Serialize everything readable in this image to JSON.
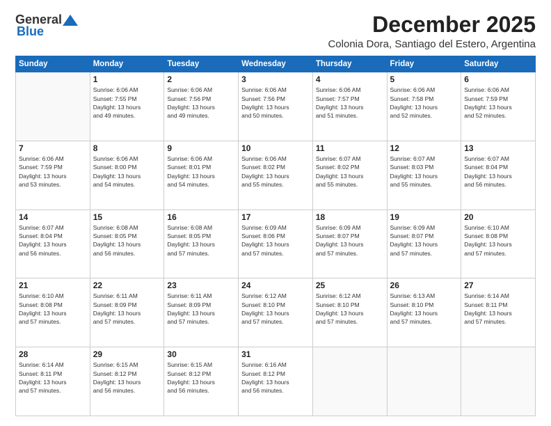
{
  "logo": {
    "general": "General",
    "blue": "Blue"
  },
  "header": {
    "month": "December 2025",
    "location": "Colonia Dora, Santiago del Estero, Argentina"
  },
  "weekdays": [
    "Sunday",
    "Monday",
    "Tuesday",
    "Wednesday",
    "Thursday",
    "Friday",
    "Saturday"
  ],
  "weeks": [
    [
      {
        "day": "",
        "info": ""
      },
      {
        "day": "1",
        "info": "Sunrise: 6:06 AM\nSunset: 7:55 PM\nDaylight: 13 hours\nand 49 minutes."
      },
      {
        "day": "2",
        "info": "Sunrise: 6:06 AM\nSunset: 7:56 PM\nDaylight: 13 hours\nand 49 minutes."
      },
      {
        "day": "3",
        "info": "Sunrise: 6:06 AM\nSunset: 7:56 PM\nDaylight: 13 hours\nand 50 minutes."
      },
      {
        "day": "4",
        "info": "Sunrise: 6:06 AM\nSunset: 7:57 PM\nDaylight: 13 hours\nand 51 minutes."
      },
      {
        "day": "5",
        "info": "Sunrise: 6:06 AM\nSunset: 7:58 PM\nDaylight: 13 hours\nand 52 minutes."
      },
      {
        "day": "6",
        "info": "Sunrise: 6:06 AM\nSunset: 7:59 PM\nDaylight: 13 hours\nand 52 minutes."
      }
    ],
    [
      {
        "day": "7",
        "info": "Sunrise: 6:06 AM\nSunset: 7:59 PM\nDaylight: 13 hours\nand 53 minutes."
      },
      {
        "day": "8",
        "info": "Sunrise: 6:06 AM\nSunset: 8:00 PM\nDaylight: 13 hours\nand 54 minutes."
      },
      {
        "day": "9",
        "info": "Sunrise: 6:06 AM\nSunset: 8:01 PM\nDaylight: 13 hours\nand 54 minutes."
      },
      {
        "day": "10",
        "info": "Sunrise: 6:06 AM\nSunset: 8:02 PM\nDaylight: 13 hours\nand 55 minutes."
      },
      {
        "day": "11",
        "info": "Sunrise: 6:07 AM\nSunset: 8:02 PM\nDaylight: 13 hours\nand 55 minutes."
      },
      {
        "day": "12",
        "info": "Sunrise: 6:07 AM\nSunset: 8:03 PM\nDaylight: 13 hours\nand 55 minutes."
      },
      {
        "day": "13",
        "info": "Sunrise: 6:07 AM\nSunset: 8:04 PM\nDaylight: 13 hours\nand 56 minutes."
      }
    ],
    [
      {
        "day": "14",
        "info": "Sunrise: 6:07 AM\nSunset: 8:04 PM\nDaylight: 13 hours\nand 56 minutes."
      },
      {
        "day": "15",
        "info": "Sunrise: 6:08 AM\nSunset: 8:05 PM\nDaylight: 13 hours\nand 56 minutes."
      },
      {
        "day": "16",
        "info": "Sunrise: 6:08 AM\nSunset: 8:05 PM\nDaylight: 13 hours\nand 57 minutes."
      },
      {
        "day": "17",
        "info": "Sunrise: 6:09 AM\nSunset: 8:06 PM\nDaylight: 13 hours\nand 57 minutes."
      },
      {
        "day": "18",
        "info": "Sunrise: 6:09 AM\nSunset: 8:07 PM\nDaylight: 13 hours\nand 57 minutes."
      },
      {
        "day": "19",
        "info": "Sunrise: 6:09 AM\nSunset: 8:07 PM\nDaylight: 13 hours\nand 57 minutes."
      },
      {
        "day": "20",
        "info": "Sunrise: 6:10 AM\nSunset: 8:08 PM\nDaylight: 13 hours\nand 57 minutes."
      }
    ],
    [
      {
        "day": "21",
        "info": "Sunrise: 6:10 AM\nSunset: 8:08 PM\nDaylight: 13 hours\nand 57 minutes."
      },
      {
        "day": "22",
        "info": "Sunrise: 6:11 AM\nSunset: 8:09 PM\nDaylight: 13 hours\nand 57 minutes."
      },
      {
        "day": "23",
        "info": "Sunrise: 6:11 AM\nSunset: 8:09 PM\nDaylight: 13 hours\nand 57 minutes."
      },
      {
        "day": "24",
        "info": "Sunrise: 6:12 AM\nSunset: 8:10 PM\nDaylight: 13 hours\nand 57 minutes."
      },
      {
        "day": "25",
        "info": "Sunrise: 6:12 AM\nSunset: 8:10 PM\nDaylight: 13 hours\nand 57 minutes."
      },
      {
        "day": "26",
        "info": "Sunrise: 6:13 AM\nSunset: 8:10 PM\nDaylight: 13 hours\nand 57 minutes."
      },
      {
        "day": "27",
        "info": "Sunrise: 6:14 AM\nSunset: 8:11 PM\nDaylight: 13 hours\nand 57 minutes."
      }
    ],
    [
      {
        "day": "28",
        "info": "Sunrise: 6:14 AM\nSunset: 8:11 PM\nDaylight: 13 hours\nand 57 minutes."
      },
      {
        "day": "29",
        "info": "Sunrise: 6:15 AM\nSunset: 8:12 PM\nDaylight: 13 hours\nand 56 minutes."
      },
      {
        "day": "30",
        "info": "Sunrise: 6:15 AM\nSunset: 8:12 PM\nDaylight: 13 hours\nand 56 minutes."
      },
      {
        "day": "31",
        "info": "Sunrise: 6:16 AM\nSunset: 8:12 PM\nDaylight: 13 hours\nand 56 minutes."
      },
      {
        "day": "",
        "info": ""
      },
      {
        "day": "",
        "info": ""
      },
      {
        "day": "",
        "info": ""
      }
    ]
  ]
}
